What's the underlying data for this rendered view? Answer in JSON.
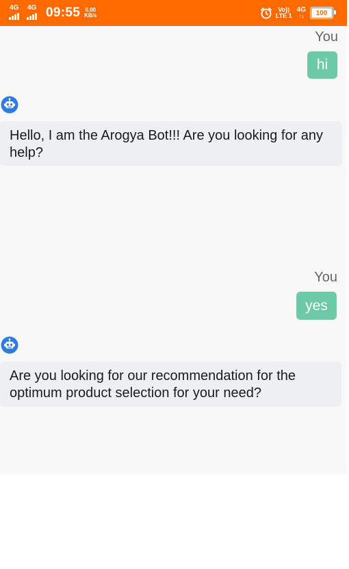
{
  "status_bar": {
    "network_1": "4G",
    "network_2": "4G",
    "time": "09:55",
    "speed_value": "0.00",
    "speed_unit": "KB/s",
    "volte_top": "Vo))",
    "volte_bottom": "LTE 1",
    "network_3": "4G",
    "network_3_arrows": "↑↓",
    "battery": "100",
    "icons": [
      "signal-icon",
      "alarm-icon",
      "battery-icon"
    ],
    "background_color": "#ff6a00"
  },
  "chat": {
    "messages": [
      {
        "sender": "You",
        "text": "hi"
      },
      {
        "sender": "bot",
        "text": "Hello, I am the Arogya Bot!!! Are you looking for any help?"
      },
      {
        "sender": "You",
        "text": "yes"
      },
      {
        "sender": "bot",
        "text": "Are you looking for our recommendation for the optimum product selection for your need?"
      }
    ],
    "colors": {
      "user_bubble": "#6ccaa6",
      "bot_bubble": "#edf0f2",
      "bot_avatar": "#2f7be0"
    }
  }
}
